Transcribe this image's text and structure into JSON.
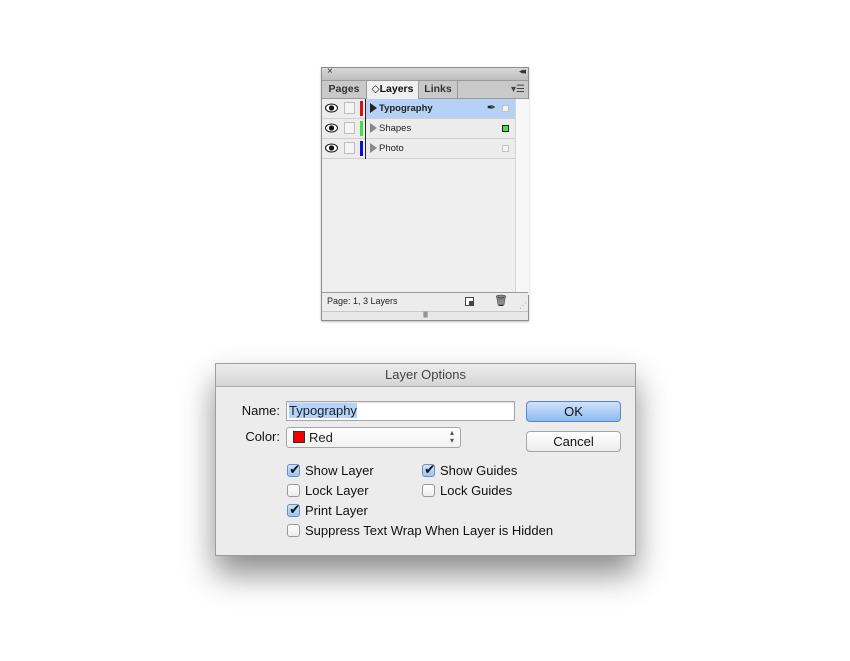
{
  "layers_panel": {
    "close_icon": "×",
    "collapse_icon": "◂◂",
    "tabs": [
      {
        "label": "Pages",
        "active": false
      },
      {
        "label": "◇Layers",
        "active": true
      },
      {
        "label": "Links",
        "active": false
      }
    ],
    "menu_icon": "▾☰",
    "layers": [
      {
        "name": "Typography",
        "color": "#e01010",
        "selected": true,
        "visible": true,
        "locked": false,
        "pen": "✒",
        "selection_filled": false
      },
      {
        "name": "Shapes",
        "color": "#3fe03f",
        "selected": false,
        "visible": true,
        "locked": false,
        "pen": "",
        "selection_filled": true
      },
      {
        "name": "Photo",
        "color": "#1010d0",
        "selected": false,
        "visible": true,
        "locked": false,
        "pen": "",
        "selection_filled": false
      }
    ],
    "footer_text": "Page: 1, 3 Layers",
    "trash_icon": "🗑",
    "grip_icon": "⋰",
    "drag_handle": "||||||||"
  },
  "dialog": {
    "title": "Layer Options",
    "name_label": "Name:",
    "name_value": "Typography",
    "color_label": "Color:",
    "color_value": "Red",
    "color_swatch": "#ee0000",
    "updown_icon": "▴▾",
    "ok_label": "OK",
    "cancel_label": "Cancel",
    "checkboxes": [
      {
        "label": "Show Layer",
        "checked": true
      },
      {
        "label": "Show Guides",
        "checked": true
      },
      {
        "label": "Lock Layer",
        "checked": false
      },
      {
        "label": "Lock Guides",
        "checked": false
      },
      {
        "label": "Print Layer",
        "checked": true
      },
      {
        "label": "Suppress Text Wrap When Layer is Hidden",
        "checked": false
      }
    ],
    "check_glyph": "✔"
  }
}
